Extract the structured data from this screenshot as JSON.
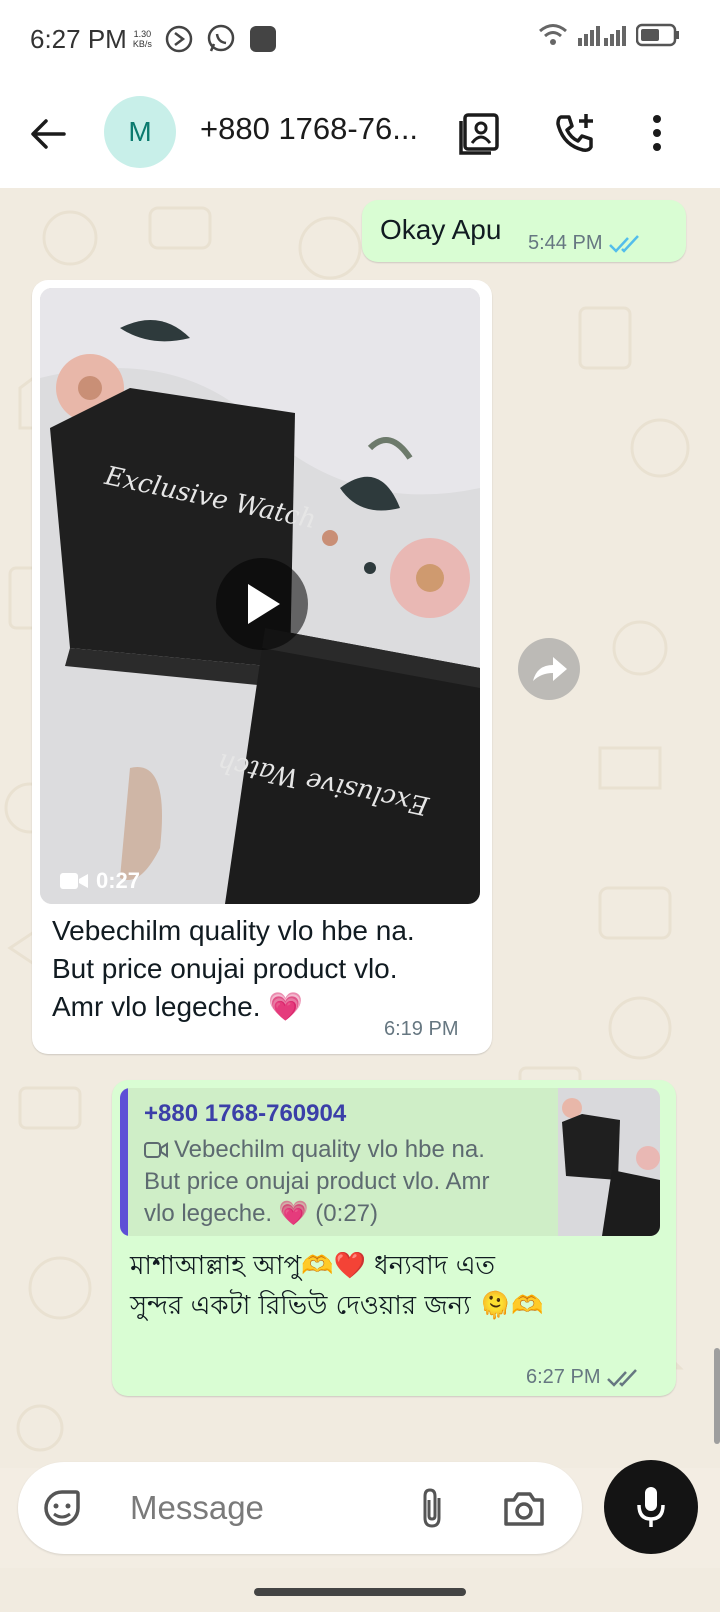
{
  "status": {
    "time": "6:27 PM",
    "speed_value": "1.30",
    "speed_unit": "KB/s"
  },
  "header": {
    "avatar_letter": "M",
    "contact_name": "+880 1768-76..."
  },
  "messages": [
    {
      "direction": "outgoing",
      "text": "Okay Apu",
      "time": "5:44 PM",
      "status": "read"
    },
    {
      "direction": "incoming",
      "media": {
        "type": "video",
        "duration": "0:27",
        "box_text": "Exclusive Watch"
      },
      "lines": [
        "Vebechilm quality vlo hbe na.",
        "But price onujai product vlo.",
        "Amr vlo legeche. 💗"
      ],
      "time": "6:19 PM"
    },
    {
      "direction": "outgoing",
      "reply_to": {
        "sender": "+880 1768-760904",
        "lines": [
          "Vebechilm quality vlo hbe na.",
          "But price onujai product vlo. Amr",
          "vlo legeche. 💗 (0:27)"
        ]
      },
      "lines": [
        "মাশাআল্লাহ আপু🫶❤️ ধন্যবাদ এত",
        "সুন্দর একটা রিভিউ দেওয়ার জন্য 🫠🫶"
      ],
      "time": "6:27 PM",
      "status": "delivered"
    }
  ],
  "composer": {
    "placeholder": "Message"
  },
  "colors": {
    "outgoing_bubble": "#d9fdd3",
    "incoming_bubble": "#ffffff",
    "read_tick": "#53bdeb",
    "quote_bar": "#5e4fd6"
  }
}
